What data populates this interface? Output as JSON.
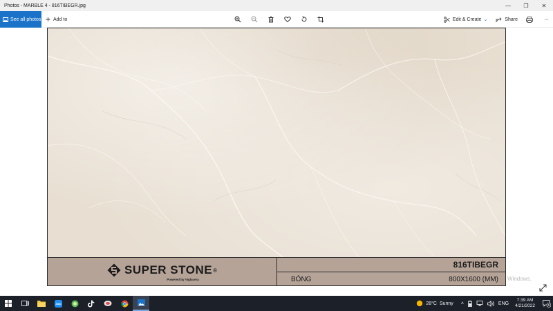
{
  "window": {
    "title": "Photos - MARBLE 4 - 816TIBEGR.jpg",
    "minimize_glyph": "—",
    "maximize_glyph": "❐",
    "close_glyph": "✕"
  },
  "toolbar": {
    "see_all_label": "See all photos",
    "add_to_label": "Add to",
    "tools": [
      "zoom-in-icon",
      "zoom-out-icon",
      "delete-icon",
      "favorite-icon",
      "rotate-icon",
      "crop-icon"
    ],
    "edit_create_label": "Edit & Create",
    "share_label": "Share",
    "more_glyph": "···",
    "accent_color": "#1a73c9"
  },
  "photo": {
    "brand_name": "SUPER STONE",
    "brand_reg": "®",
    "brand_tagline": "Powered by Viglacera",
    "product_code": "816TIBEGR",
    "finish": "BÓNG",
    "size": "800X1600 (MM)",
    "band_color": "#b5a397",
    "marble_color": "#e8dfd2"
  },
  "viewer": {
    "activation_watermark": "Windows."
  },
  "taskbar": {
    "apps": [
      "start-icon",
      "task-view-icon",
      "file-explorer-icon",
      "zalo-icon",
      "app-green-icon",
      "tiktok-icon",
      "app-cloud-icon",
      "chrome-icon",
      "photos-icon"
    ],
    "weather_temp": "28°C",
    "weather_desc": "Sunny",
    "language": "ENG",
    "time": "7:39 AM",
    "date": "4/21/2022",
    "notification_count": "5"
  }
}
